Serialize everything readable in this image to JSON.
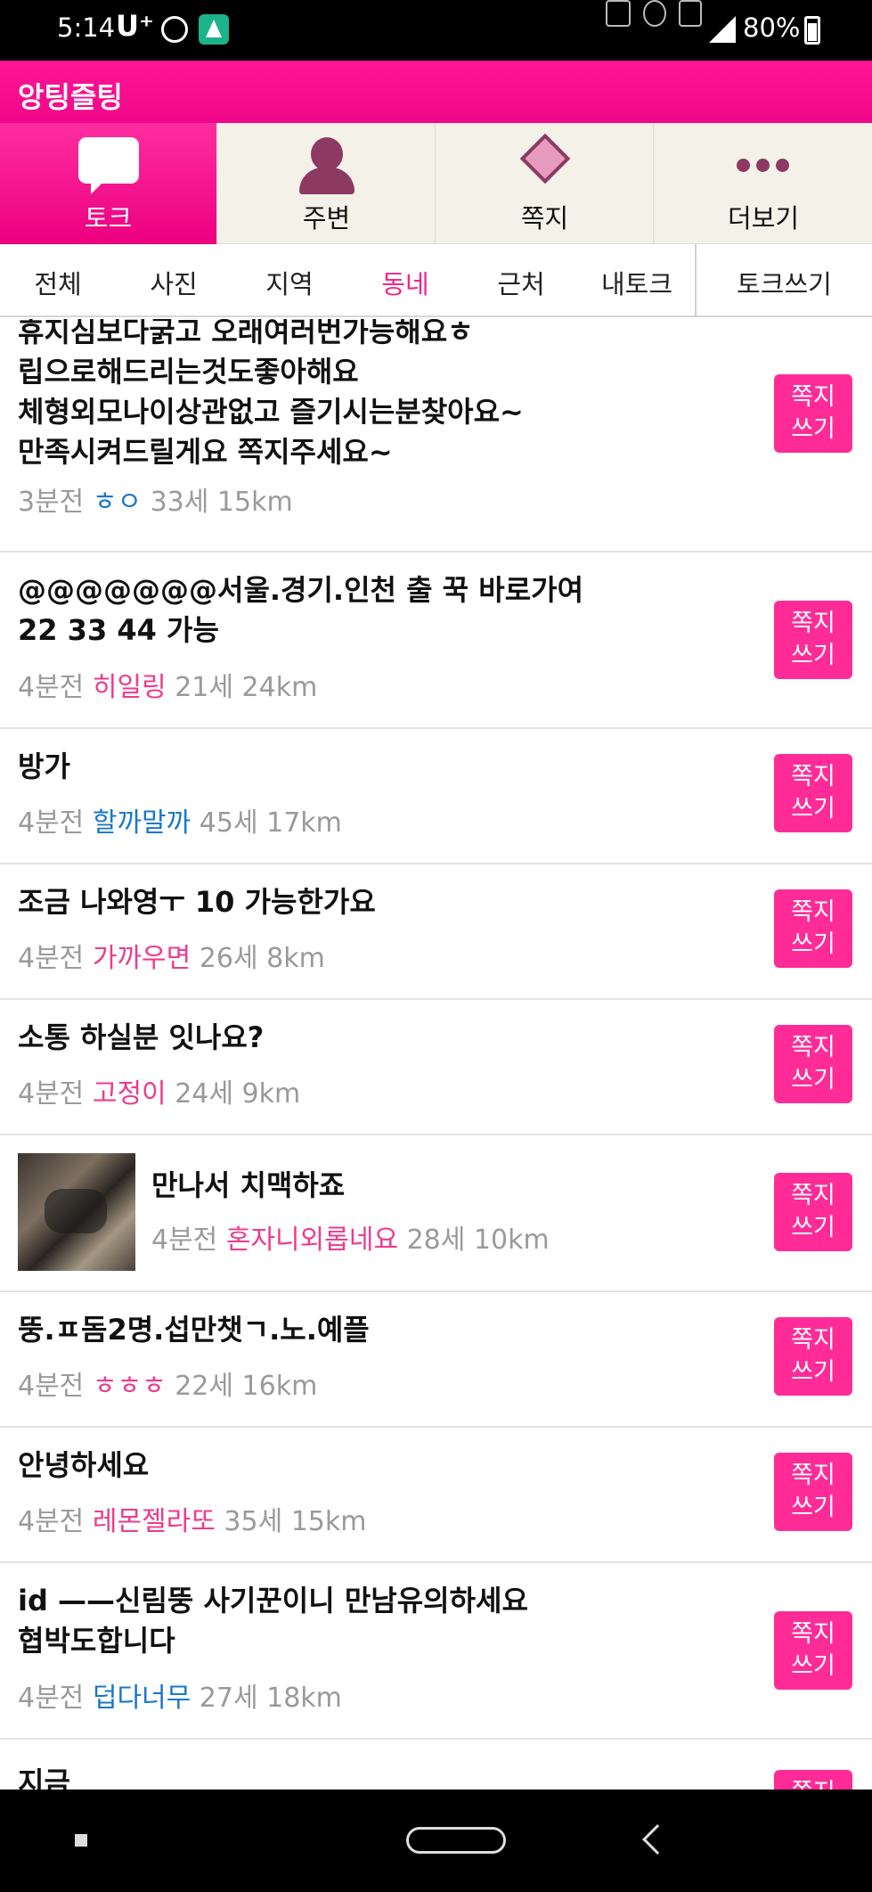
{
  "status_bar": {
    "time": "5:14",
    "carrier": "U⁺",
    "battery": "80%",
    "icons": [
      "walk-icon",
      "app-icon",
      "bluetooth-icon",
      "nfc-icon",
      "alarm-icon",
      "lte-icon",
      "signal-icon",
      "battery-icon"
    ]
  },
  "app": {
    "title": "앙팅즐팅",
    "accent": "#ff1493"
  },
  "main_tabs": [
    {
      "label": "토크",
      "icon": "chat-bubble-icon",
      "active": true
    },
    {
      "label": "주변",
      "icon": "person-icon",
      "active": false
    },
    {
      "label": "쪽지",
      "icon": "note-icon",
      "active": false
    },
    {
      "label": "더보기",
      "icon": "more-dots-icon",
      "active": false
    }
  ],
  "sub_tabs": [
    {
      "label": "전체"
    },
    {
      "label": "사진"
    },
    {
      "label": "지역"
    },
    {
      "label": "동네",
      "active": true
    },
    {
      "label": "근처"
    },
    {
      "label": "내토크"
    }
  ],
  "write_label": "토크쓰기",
  "message_button_label": "쪽지\n쓰기",
  "posts": [
    {
      "text": "휴지심보다굵고 오래여러번가능해요ㅎ\n립으로해드리는것도좋아해요\n체형외모나이상관없고 즐기시는분찾아요~\n만족시켜드릴게요 쪽지주세요~",
      "time": "3분전",
      "nick": "ㅎㅇ",
      "nick_color": "blue",
      "age": "33세",
      "distance": "15km"
    },
    {
      "text": "@@@@@@@서울.경기.인천 출 꾹 바로가여\n22 33 44  가능",
      "time": "4분전",
      "nick": "히일링",
      "nick_color": "pink",
      "age": "21세",
      "distance": "24km"
    },
    {
      "text": "방가",
      "time": "4분전",
      "nick": "할까말까",
      "nick_color": "blue",
      "age": "45세",
      "distance": "17km"
    },
    {
      "text": "조금 나와영ㅜ 10 가능한가요",
      "time": "4분전",
      "nick": "가까우면",
      "nick_color": "pink",
      "age": "26세",
      "distance": "8km"
    },
    {
      "text": "소통 하실분 잇나요?",
      "time": "4분전",
      "nick": "고정이",
      "nick_color": "pink",
      "age": "24세",
      "distance": "9km"
    },
    {
      "text": "만나서 치맥하죠",
      "time": "4분전",
      "nick": "혼자니외롭네요",
      "nick_color": "pink",
      "age": "28세",
      "distance": "10km",
      "has_photo": true
    },
    {
      "text": "뚱.ㅍ돔2명.섭만챗ㄱ.노.예플",
      "time": "4분전",
      "nick": "ㅎㅎㅎ",
      "nick_color": "pink",
      "age": "22세",
      "distance": "16km"
    },
    {
      "text": "안녕하세요",
      "time": "4분전",
      "nick": "레몬젤라또",
      "nick_color": "pink",
      "age": "35세",
      "distance": "15km"
    },
    {
      "text": "id ——신림뚱 사기꾼이니 만남유의하세요\n협박도합니다",
      "time": "4분전",
      "nick": "덥다너무",
      "nick_color": "blue",
      "age": "27세",
      "distance": "18km"
    },
    {
      "text": "지금",
      "time": "",
      "nick": "",
      "nick_color": "pink",
      "age": "",
      "distance": ""
    }
  ]
}
